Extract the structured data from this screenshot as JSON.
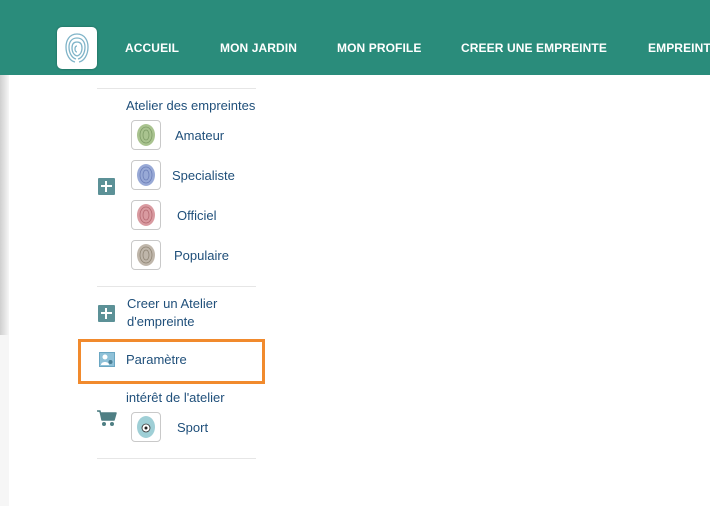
{
  "colors": {
    "header": "#2a8c7b",
    "highlight": "#f18a2d",
    "link": "#1f4f7a"
  },
  "header": {
    "logo_icon": "fingerprint-icon",
    "nav": [
      "ACCUEIL",
      "MON JARDIN",
      "MON PROFILE",
      "CREER UNE EMPREINTE",
      "EMPREINT"
    ]
  },
  "sidebar": {
    "atelier_title": "Atelier des empreintes",
    "ateliers": [
      {
        "label": "Amateur",
        "icon": "green-fingerprint-icon",
        "color": "#8fb07a"
      },
      {
        "label": "Specialiste",
        "icon": "blue-fingerprint-icon",
        "color": "#7f93c4"
      },
      {
        "label": "Officiel",
        "icon": "red-fingerprint-icon",
        "color": "#c97a82"
      },
      {
        "label": "Populaire",
        "icon": "gray-fingerprint-icon",
        "color": "#a39a8e"
      }
    ],
    "create_line1": "Creer un Atelier",
    "create_line2": "d'empreinte",
    "settings": "Paramètre",
    "interest_title": "intérêt de l'atelier",
    "interest_items": [
      {
        "label": "Sport",
        "icon": "soccer-fingerprint-icon"
      }
    ]
  }
}
